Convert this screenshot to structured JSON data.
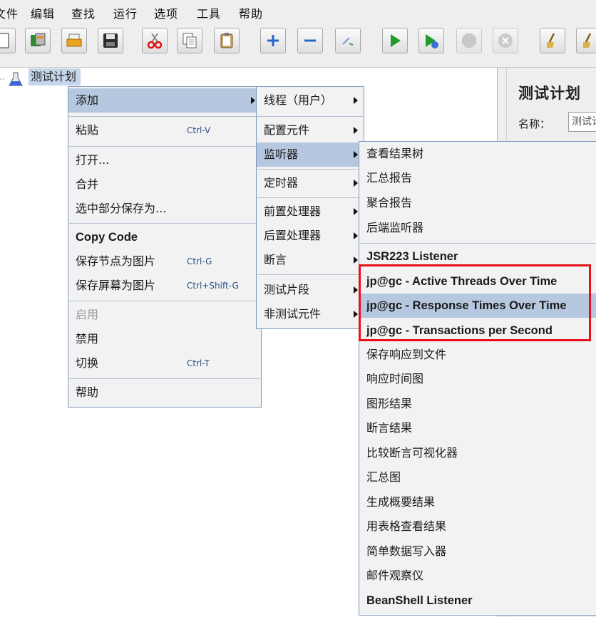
{
  "menubar": [
    "文件",
    "编辑",
    "查找",
    "运行",
    "选项",
    "工具",
    "帮助"
  ],
  "toolbar_icons": [
    "new-icon",
    "templates-icon",
    "open-icon",
    "save-icon",
    "cut-icon",
    "copy-icon",
    "paste-icon",
    "expand-icon",
    "collapse-icon",
    "toggle-icon",
    "start-icon",
    "start-no-pause-icon",
    "stop-icon",
    "shutdown-icon",
    "clear-icon",
    "clear-all-icon"
  ],
  "tree": {
    "node_label": "测试计划"
  },
  "right_panel": {
    "title": "测试计划",
    "name_label": "名称：",
    "name_value": "测试计划"
  },
  "context_menu": {
    "add": "添加",
    "paste": "粘贴",
    "paste_shortcut": "Ctrl-V",
    "open": "打开...",
    "merge": "合并",
    "save_selection": "选中部分保存为...",
    "copy_code": "Copy Code",
    "save_node_image": "保存节点为图片",
    "save_node_image_shortcut": "Ctrl-G",
    "save_screen_image": "保存屏幕为图片",
    "save_screen_image_shortcut": "Ctrl+Shift-G",
    "enable": "启用",
    "disable": "禁用",
    "toggle": "切换",
    "toggle_shortcut": "Ctrl-T",
    "help": "帮助"
  },
  "add_submenu": {
    "threads": "线程（用户）",
    "config": "配置元件",
    "listener": "监听器",
    "timer": "定时器",
    "pre_processor": "前置处理器",
    "post_processor": "后置处理器",
    "assertion": "断言",
    "test_fragment": "测试片段",
    "non_test": "非测试元件"
  },
  "listener_submenu": [
    "查看结果树",
    "汇总报告",
    "聚合报告",
    "后端监听器",
    "JSR223 Listener",
    "jp@gc - Active Threads Over Time",
    "jp@gc - Response Times Over Time",
    "jp@gc - Transactions per Second",
    "保存响应到文件",
    "响应时间图",
    "图形结果",
    "断言结果",
    "比较断言可视化器",
    "汇总图",
    "生成概要结果",
    "用表格查看结果",
    "简单数据写入器",
    "邮件观察仪",
    "BeanShell Listener"
  ],
  "colors": {
    "highlight": "#b6c8df",
    "red_box": "#e8101b"
  }
}
